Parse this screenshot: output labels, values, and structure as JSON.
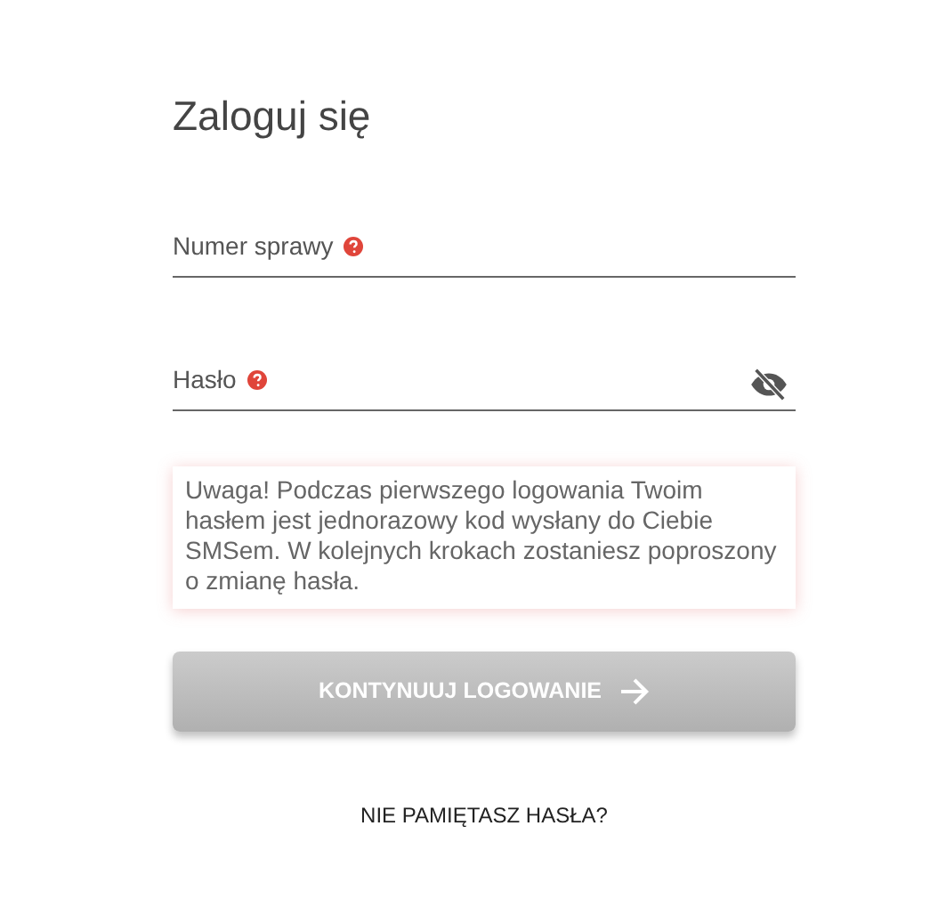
{
  "title": "Zaloguj się",
  "fields": [
    {
      "kind": "text",
      "label": "Numer sprawy",
      "help": true
    },
    {
      "kind": "password",
      "label": "Hasło",
      "help": true,
      "password_visible": false
    }
  ],
  "notice": "Uwaga! Podczas pierwszego logowania Twoim hasłem jest jednorazowy kod wysłany do Ciebie SMSem. W kolejnych krokach zostaniesz poproszony o zmianę hasła.",
  "submit": {
    "label": "KONTYNUUJ LOGOWANIE",
    "disabled": true
  },
  "forgot_link": "NIE PAMIĘTASZ HASŁA?"
}
